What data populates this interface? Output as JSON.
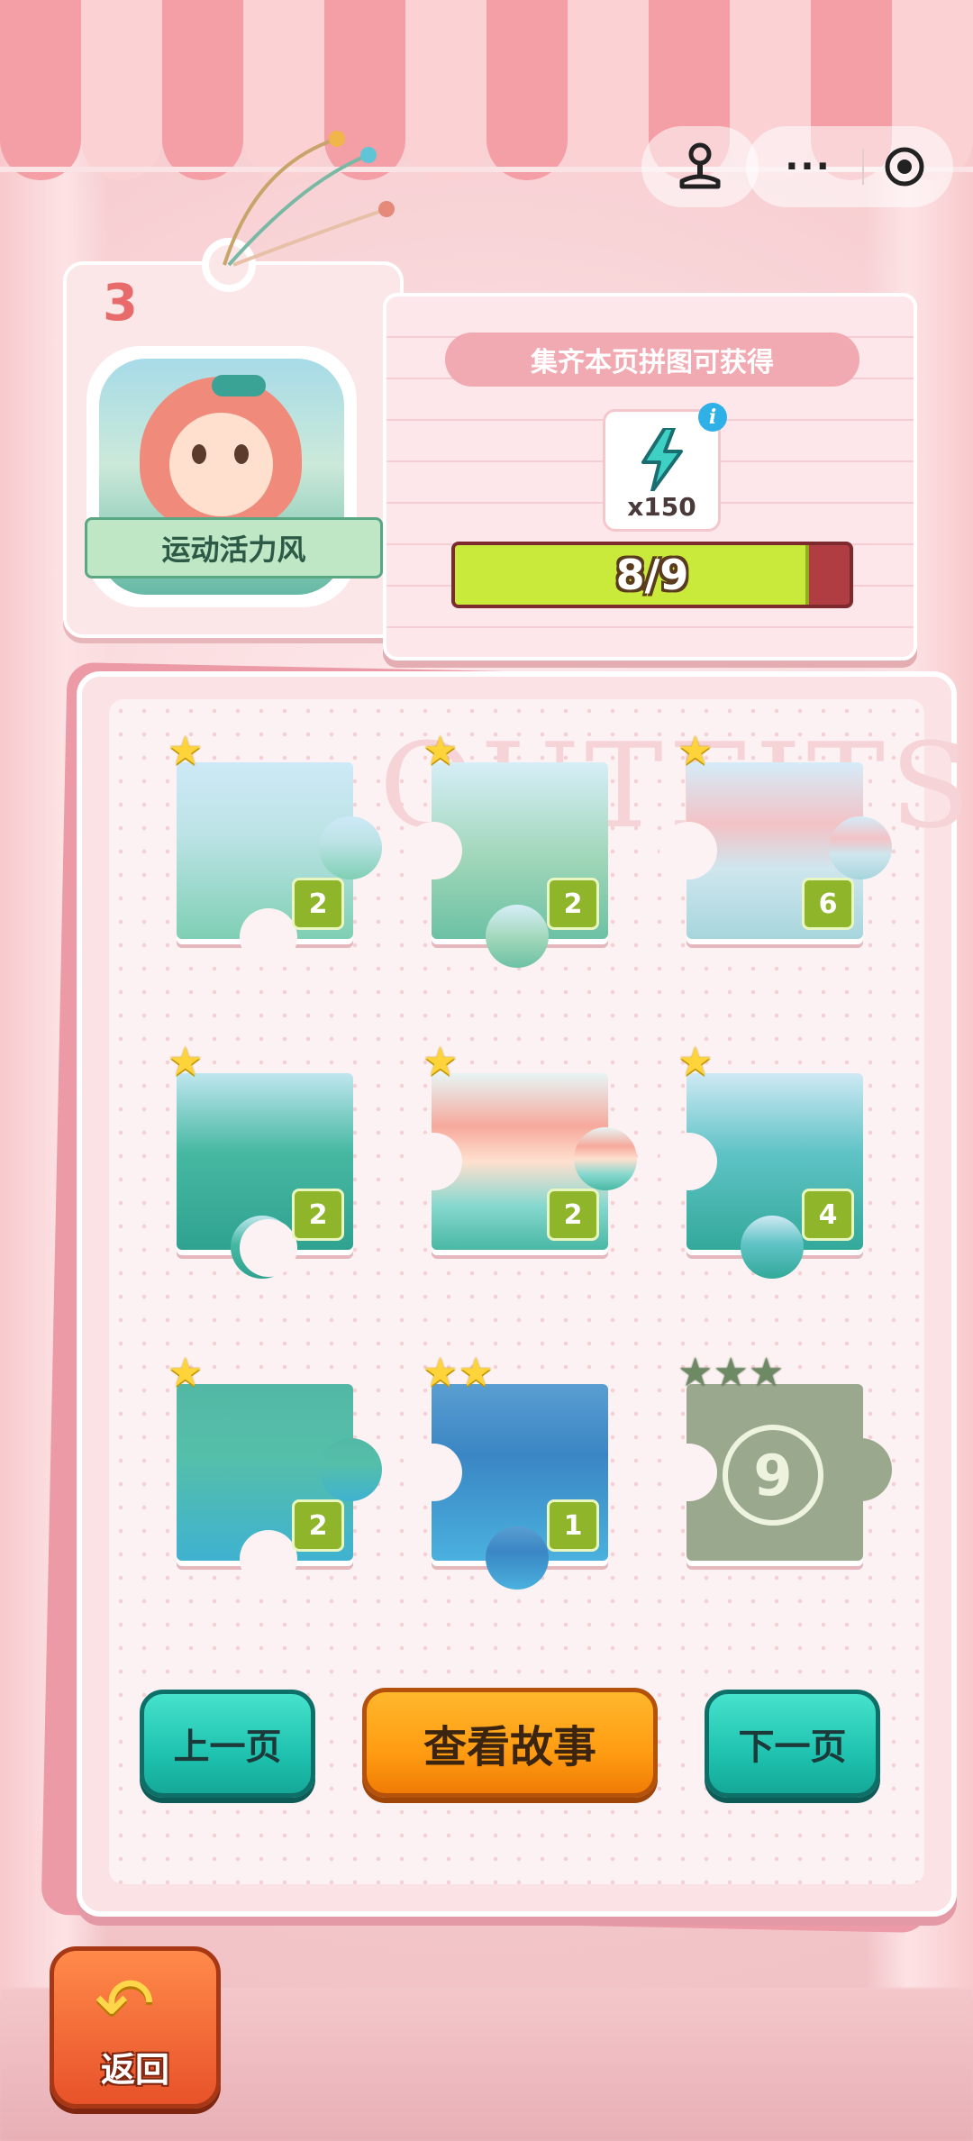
{
  "colors": {
    "awning_pink": "#f49ea6",
    "awning_light": "#fbd1d4",
    "teal_button": "#1fc3b0",
    "orange_button": "#ff9c12",
    "progress_fill": "#c9ea3a",
    "progress_empty": "#b03d42",
    "badge_green": "#8fb52a",
    "star_gold": "#ffd43a",
    "locked_grey": "#9aa98d"
  },
  "top_bar": {
    "joystick_icon": "joystick-icon",
    "more_label": "···",
    "record_icon": "target-icon"
  },
  "character_card": {
    "page_number": "3",
    "outfit_name": "运动活力风"
  },
  "reward_card": {
    "title": "集齐本页拼图可获得",
    "item_icon": "lightning-bolt-icon",
    "item_quantity": "x150",
    "info_label": "i",
    "progress_text": "8/9",
    "progress_fraction": 0.889
  },
  "board": {
    "watermark": "OUTFITS",
    "pieces": [
      {
        "id": 1,
        "stars": 1,
        "badge": "2",
        "locked": false
      },
      {
        "id": 2,
        "stars": 1,
        "badge": "2",
        "locked": false
      },
      {
        "id": 3,
        "stars": 1,
        "badge": "6",
        "locked": false
      },
      {
        "id": 4,
        "stars": 1,
        "badge": "2",
        "locked": false
      },
      {
        "id": 5,
        "stars": 1,
        "badge": "2",
        "locked": false
      },
      {
        "id": 6,
        "stars": 1,
        "badge": "4",
        "locked": false
      },
      {
        "id": 7,
        "stars": 1,
        "badge": "2",
        "locked": false
      },
      {
        "id": 8,
        "stars": 2,
        "badge": "1",
        "locked": false
      },
      {
        "id": 9,
        "stars": 3,
        "badge": "9",
        "locked": true
      }
    ]
  },
  "buttons": {
    "prev_page": "上一页",
    "view_story": "查看故事",
    "next_page": "下一页",
    "back": "返回"
  }
}
